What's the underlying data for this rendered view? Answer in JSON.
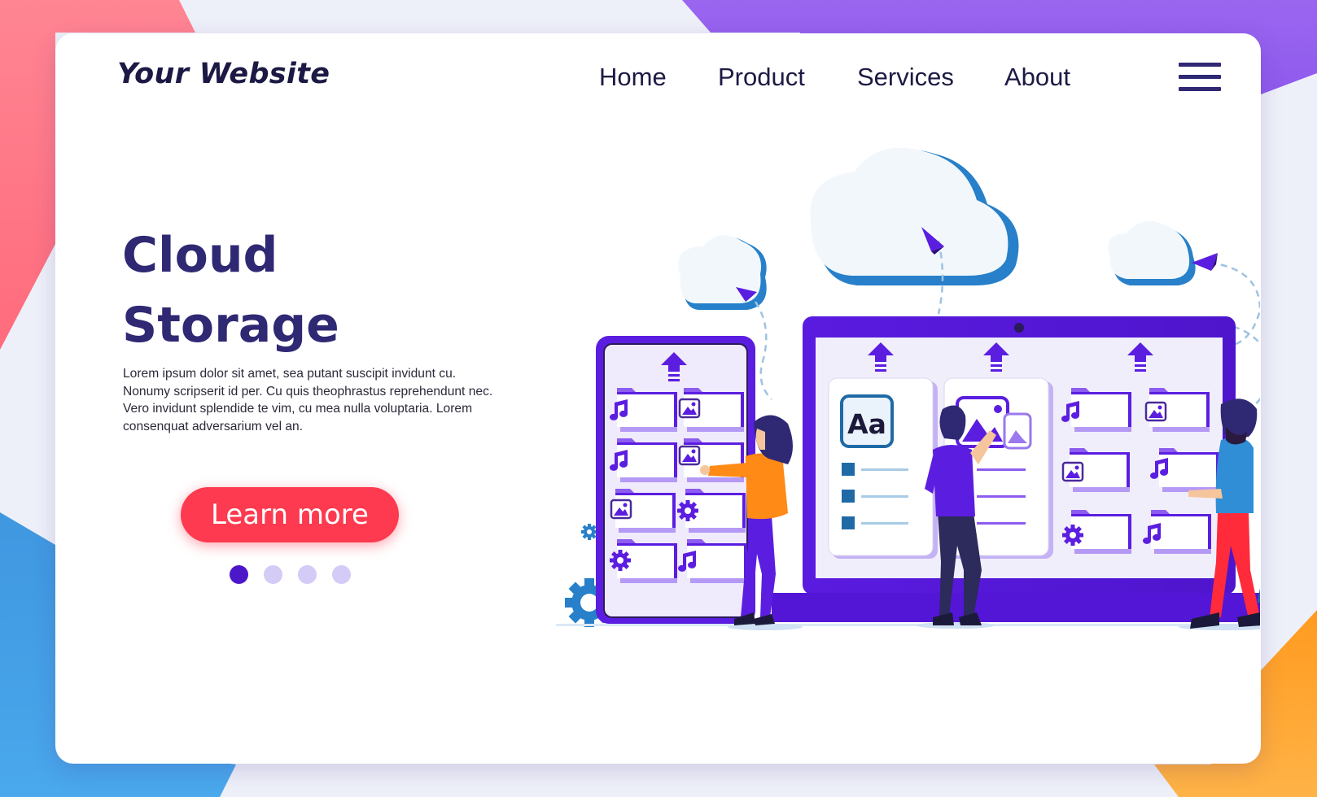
{
  "header": {
    "brand": "Your Website",
    "nav": [
      {
        "label": "Home"
      },
      {
        "label": "Product"
      },
      {
        "label": "Services"
      },
      {
        "label": "About"
      }
    ],
    "menu_icon": "hamburger-menu-icon"
  },
  "hero": {
    "title_line1": "Cloud",
    "title_line2": "Storage",
    "description": "Lorem ipsum dolor sit amet, sea putant suscipit invidunt cu. Nonumy scripserit id per. Cu quis theophrastus reprehendunt nec. Vero invidunt splendide te vim, cu mea nulla voluptaria. Lorem consenquat adversarium vel an.",
    "cta_label": "Learn more",
    "pagination": {
      "total": 4,
      "active": 1
    }
  },
  "illustration": {
    "text_card_label": "Aa",
    "icons": [
      "cloud-icon",
      "paper-plane-icon",
      "folder-icon",
      "music-note-icon",
      "image-icon",
      "gear-icon",
      "upload-arrow-icon"
    ]
  },
  "colors": {
    "primary": "#2f2873",
    "accent_purple": "#5b1ee0",
    "cta_red": "#fd3a4f",
    "cloud_blue": "#2780c9",
    "dot_active": "#4c17c9",
    "dot_inactive": "#d4cbf6"
  }
}
